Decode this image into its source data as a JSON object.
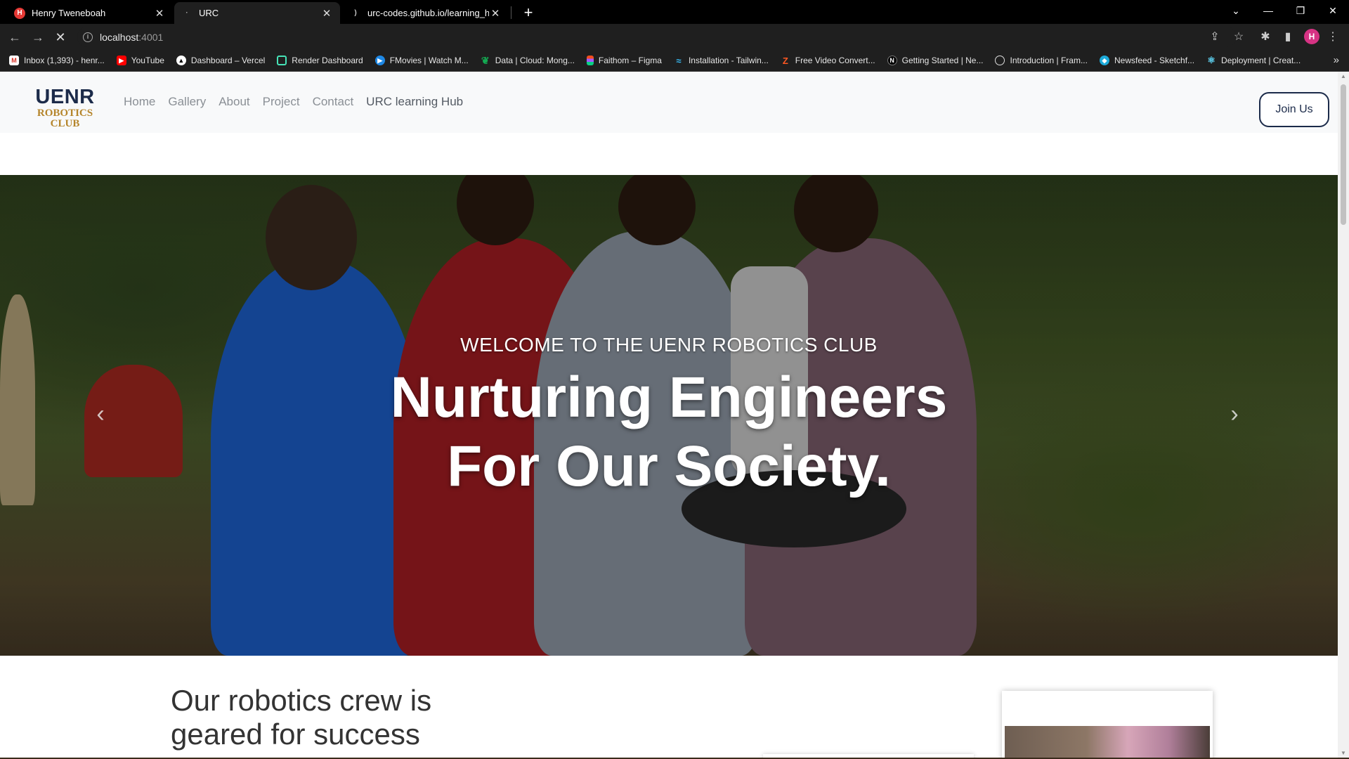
{
  "browser": {
    "tabs": [
      {
        "title": "Henry Tweneboah",
        "active": false
      },
      {
        "title": "URC",
        "active": true
      },
      {
        "title": "urc-codes.github.io/learning_hub",
        "active": false
      }
    ],
    "url_host": "localhost",
    "url_port": ":4001",
    "profile_initial": "H",
    "bookmarks": [
      "Inbox (1,393) - henr...",
      "YouTube",
      "Dashboard – Vercel",
      "Render Dashboard",
      "FMovies | Watch M...",
      "Data | Cloud: Mong...",
      "Faithom – Figma",
      "Installation - Tailwin...",
      "Free Video Convert...",
      "Getting Started | Ne...",
      "Introduction | Fram...",
      "Newsfeed - Sketchf...",
      "Deployment | Creat..."
    ]
  },
  "site": {
    "logo_top": "UENR",
    "logo_bottom": "ROBOTICS CLUB",
    "nav": [
      "Home",
      "Gallery",
      "About",
      "Project",
      "Contact",
      "URC learning Hub"
    ],
    "join_label": "Join Us",
    "hero_kicker": "WELCOME TO THE UENR ROBOTICS CLUB",
    "hero_line1": "Nurturing Engineers",
    "hero_line2": "For Our Society.",
    "section_heading_line1": "Our robotics crew is",
    "section_heading_line2": "geared for success"
  },
  "colors": {
    "brand_navy": "#1c2b4a",
    "brand_gold": "#b5852b"
  }
}
